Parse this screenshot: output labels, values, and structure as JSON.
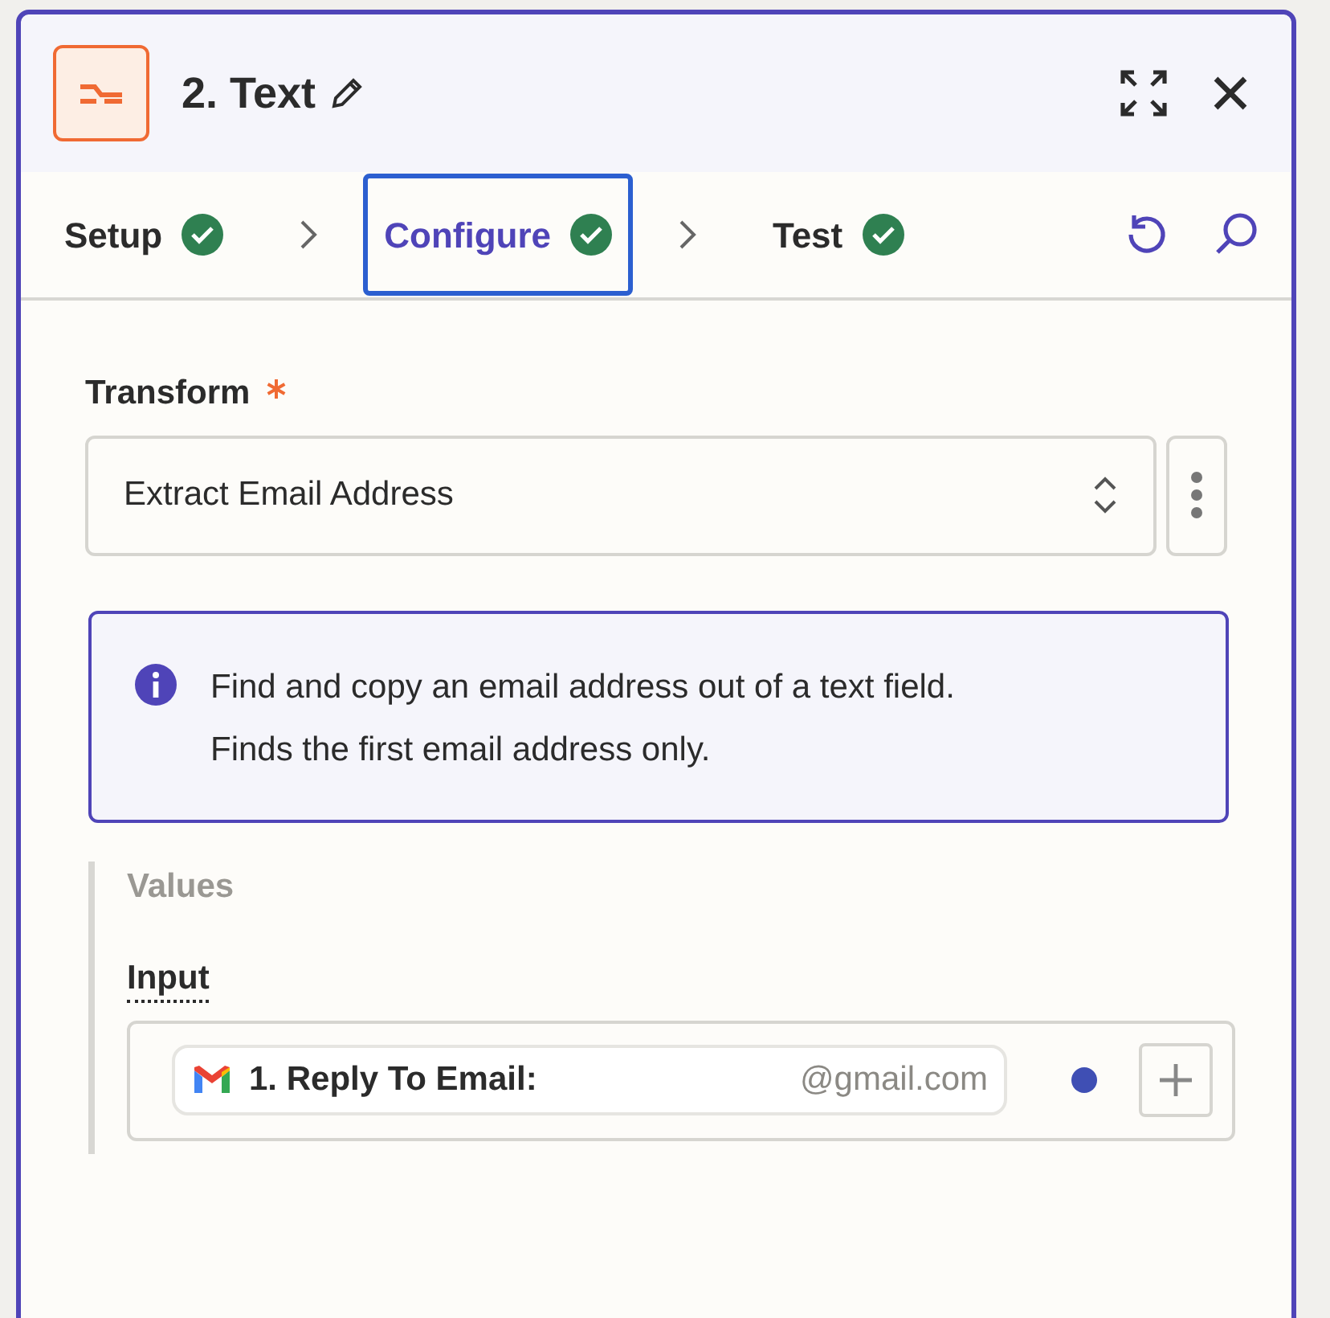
{
  "header": {
    "title": "2. Text"
  },
  "tabs": [
    {
      "label": "Setup",
      "selected": false,
      "complete": true
    },
    {
      "label": "Configure",
      "selected": true,
      "complete": true
    },
    {
      "label": "Test",
      "selected": false,
      "complete": true
    }
  ],
  "transform": {
    "label": "Transform",
    "required": true,
    "value": "Extract Email Address"
  },
  "info": {
    "lines": [
      "Find and copy an email address out of a text field.",
      "Finds the first email address only."
    ]
  },
  "values": {
    "heading": "Values",
    "input": {
      "label": "Input",
      "pill_label": "1. Reply To Email:",
      "pill_value": "@gmail.com"
    }
  }
}
